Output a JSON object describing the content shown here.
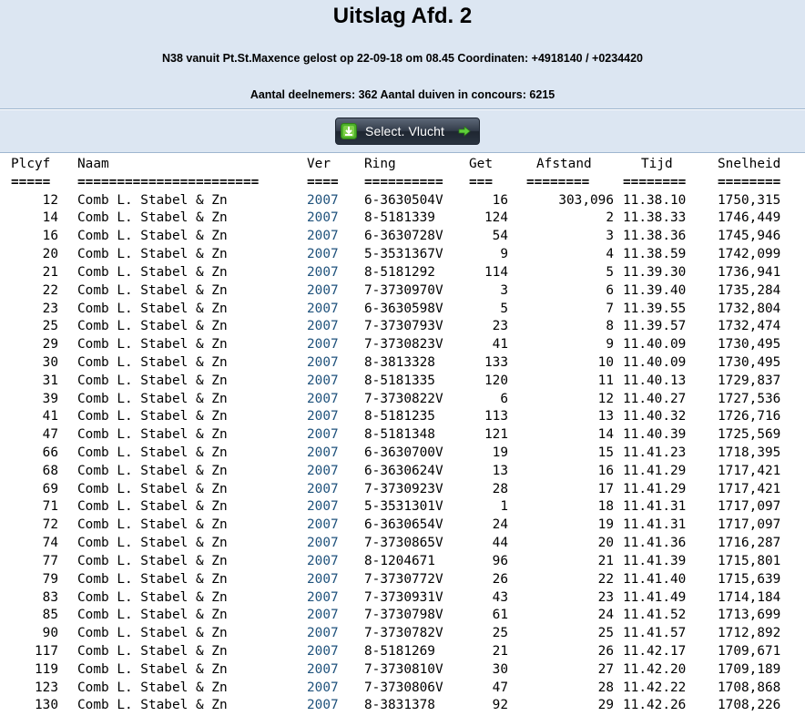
{
  "header": {
    "title": "Uitslag Afd. 2",
    "subtitle": "N38 vanuit Pt.St.Maxence gelost op 22-09-18 om 08.45 Coordinaten: +4918140 / +0234420",
    "stats": "Aantal deelnemers: 362 Aantal duiven in concours: 6215"
  },
  "select_button": {
    "label": "Select. Vlucht"
  },
  "table": {
    "columns": {
      "plcyf": "Plcyf",
      "naam": "Naam",
      "ver": "Ver",
      "ring": "Ring",
      "get": "Get",
      "afstand": "Afstand",
      "tijd": "Tijd",
      "snelheid": "Snelheid"
    },
    "separators": {
      "plcyf": "=====",
      "naam": "=======================",
      "ver": "====",
      "ring": "==========",
      "get": "===",
      "afstand": "========",
      "tijd": "========",
      "snelheid": "========"
    },
    "rows": [
      {
        "plcyf": "12",
        "naam": "Comb L. Stabel & Zn",
        "ver": "2007",
        "ring": "6-3630504V",
        "get": "16",
        "afstand": "303,096",
        "tijd": "11.38.10",
        "snelheid": "1750,315"
      },
      {
        "plcyf": "14",
        "naam": "Comb L. Stabel & Zn",
        "ver": "2007",
        "ring": "8-5181339",
        "get": "124",
        "afstand": "2",
        "tijd": "11.38.33",
        "snelheid": "1746,449"
      },
      {
        "plcyf": "16",
        "naam": "Comb L. Stabel & Zn",
        "ver": "2007",
        "ring": "6-3630728V",
        "get": "54",
        "afstand": "3",
        "tijd": "11.38.36",
        "snelheid": "1745,946"
      },
      {
        "plcyf": "20",
        "naam": "Comb L. Stabel & Zn",
        "ver": "2007",
        "ring": "5-3531367V",
        "get": "9",
        "afstand": "4",
        "tijd": "11.38.59",
        "snelheid": "1742,099"
      },
      {
        "plcyf": "21",
        "naam": "Comb L. Stabel & Zn",
        "ver": "2007",
        "ring": "8-5181292",
        "get": "114",
        "afstand": "5",
        "tijd": "11.39.30",
        "snelheid": "1736,941"
      },
      {
        "plcyf": "22",
        "naam": "Comb L. Stabel & Zn",
        "ver": "2007",
        "ring": "7-3730970V",
        "get": "3",
        "afstand": "6",
        "tijd": "11.39.40",
        "snelheid": "1735,284"
      },
      {
        "plcyf": "23",
        "naam": "Comb L. Stabel & Zn",
        "ver": "2007",
        "ring": "6-3630598V",
        "get": "5",
        "afstand": "7",
        "tijd": "11.39.55",
        "snelheid": "1732,804"
      },
      {
        "plcyf": "25",
        "naam": "Comb L. Stabel & Zn",
        "ver": "2007",
        "ring": "7-3730793V",
        "get": "23",
        "afstand": "8",
        "tijd": "11.39.57",
        "snelheid": "1732,474"
      },
      {
        "plcyf": "29",
        "naam": "Comb L. Stabel & Zn",
        "ver": "2007",
        "ring": "7-3730823V",
        "get": "41",
        "afstand": "9",
        "tijd": "11.40.09",
        "snelheid": "1730,495"
      },
      {
        "plcyf": "30",
        "naam": "Comb L. Stabel & Zn",
        "ver": "2007",
        "ring": "8-3813328",
        "get": "133",
        "afstand": "10",
        "tijd": "11.40.09",
        "snelheid": "1730,495"
      },
      {
        "plcyf": "31",
        "naam": "Comb L. Stabel & Zn",
        "ver": "2007",
        "ring": "8-5181335",
        "get": "120",
        "afstand": "11",
        "tijd": "11.40.13",
        "snelheid": "1729,837"
      },
      {
        "plcyf": "39",
        "naam": "Comb L. Stabel & Zn",
        "ver": "2007",
        "ring": "7-3730822V",
        "get": "6",
        "afstand": "12",
        "tijd": "11.40.27",
        "snelheid": "1727,536"
      },
      {
        "plcyf": "41",
        "naam": "Comb L. Stabel & Zn",
        "ver": "2007",
        "ring": "8-5181235",
        "get": "113",
        "afstand": "13",
        "tijd": "11.40.32",
        "snelheid": "1726,716"
      },
      {
        "plcyf": "47",
        "naam": "Comb L. Stabel & Zn",
        "ver": "2007",
        "ring": "8-5181348",
        "get": "121",
        "afstand": "14",
        "tijd": "11.40.39",
        "snelheid": "1725,569"
      },
      {
        "plcyf": "66",
        "naam": "Comb L. Stabel & Zn",
        "ver": "2007",
        "ring": "6-3630700V",
        "get": "19",
        "afstand": "15",
        "tijd": "11.41.23",
        "snelheid": "1718,395"
      },
      {
        "plcyf": "68",
        "naam": "Comb L. Stabel & Zn",
        "ver": "2007",
        "ring": "6-3630624V",
        "get": "13",
        "afstand": "16",
        "tijd": "11.41.29",
        "snelheid": "1717,421"
      },
      {
        "plcyf": "69",
        "naam": "Comb L. Stabel & Zn",
        "ver": "2007",
        "ring": "7-3730923V",
        "get": "28",
        "afstand": "17",
        "tijd": "11.41.29",
        "snelheid": "1717,421"
      },
      {
        "plcyf": "71",
        "naam": "Comb L. Stabel & Zn",
        "ver": "2007",
        "ring": "5-3531301V",
        "get": "1",
        "afstand": "18",
        "tijd": "11.41.31",
        "snelheid": "1717,097"
      },
      {
        "plcyf": "72",
        "naam": "Comb L. Stabel & Zn",
        "ver": "2007",
        "ring": "6-3630654V",
        "get": "24",
        "afstand": "19",
        "tijd": "11.41.31",
        "snelheid": "1717,097"
      },
      {
        "plcyf": "74",
        "naam": "Comb L. Stabel & Zn",
        "ver": "2007",
        "ring": "7-3730865V",
        "get": "44",
        "afstand": "20",
        "tijd": "11.41.36",
        "snelheid": "1716,287"
      },
      {
        "plcyf": "77",
        "naam": "Comb L. Stabel & Zn",
        "ver": "2007",
        "ring": "8-1204671",
        "get": "96",
        "afstand": "21",
        "tijd": "11.41.39",
        "snelheid": "1715,801"
      },
      {
        "plcyf": "79",
        "naam": "Comb L. Stabel & Zn",
        "ver": "2007",
        "ring": "7-3730772V",
        "get": "26",
        "afstand": "22",
        "tijd": "11.41.40",
        "snelheid": "1715,639"
      },
      {
        "plcyf": "83",
        "naam": "Comb L. Stabel & Zn",
        "ver": "2007",
        "ring": "7-3730931V",
        "get": "43",
        "afstand": "23",
        "tijd": "11.41.49",
        "snelheid": "1714,184"
      },
      {
        "plcyf": "85",
        "naam": "Comb L. Stabel & Zn",
        "ver": "2007",
        "ring": "7-3730798V",
        "get": "61",
        "afstand": "24",
        "tijd": "11.41.52",
        "snelheid": "1713,699"
      },
      {
        "plcyf": "90",
        "naam": "Comb L. Stabel & Zn",
        "ver": "2007",
        "ring": "7-3730782V",
        "get": "25",
        "afstand": "25",
        "tijd": "11.41.57",
        "snelheid": "1712,892"
      },
      {
        "plcyf": "117",
        "naam": "Comb L. Stabel & Zn",
        "ver": "2007",
        "ring": "8-5181269",
        "get": "21",
        "afstand": "26",
        "tijd": "11.42.17",
        "snelheid": "1709,671"
      },
      {
        "plcyf": "119",
        "naam": "Comb L. Stabel & Zn",
        "ver": "2007",
        "ring": "7-3730810V",
        "get": "30",
        "afstand": "27",
        "tijd": "11.42.20",
        "snelheid": "1709,189"
      },
      {
        "plcyf": "123",
        "naam": "Comb L. Stabel & Zn",
        "ver": "2007",
        "ring": "7-3730806V",
        "get": "47",
        "afstand": "28",
        "tijd": "11.42.22",
        "snelheid": "1708,868"
      },
      {
        "plcyf": "130",
        "naam": "Comb L. Stabel & Zn",
        "ver": "2007",
        "ring": "8-3831378",
        "get": "92",
        "afstand": "29",
        "tijd": "11.42.26",
        "snelheid": "1708,226"
      }
    ]
  }
}
